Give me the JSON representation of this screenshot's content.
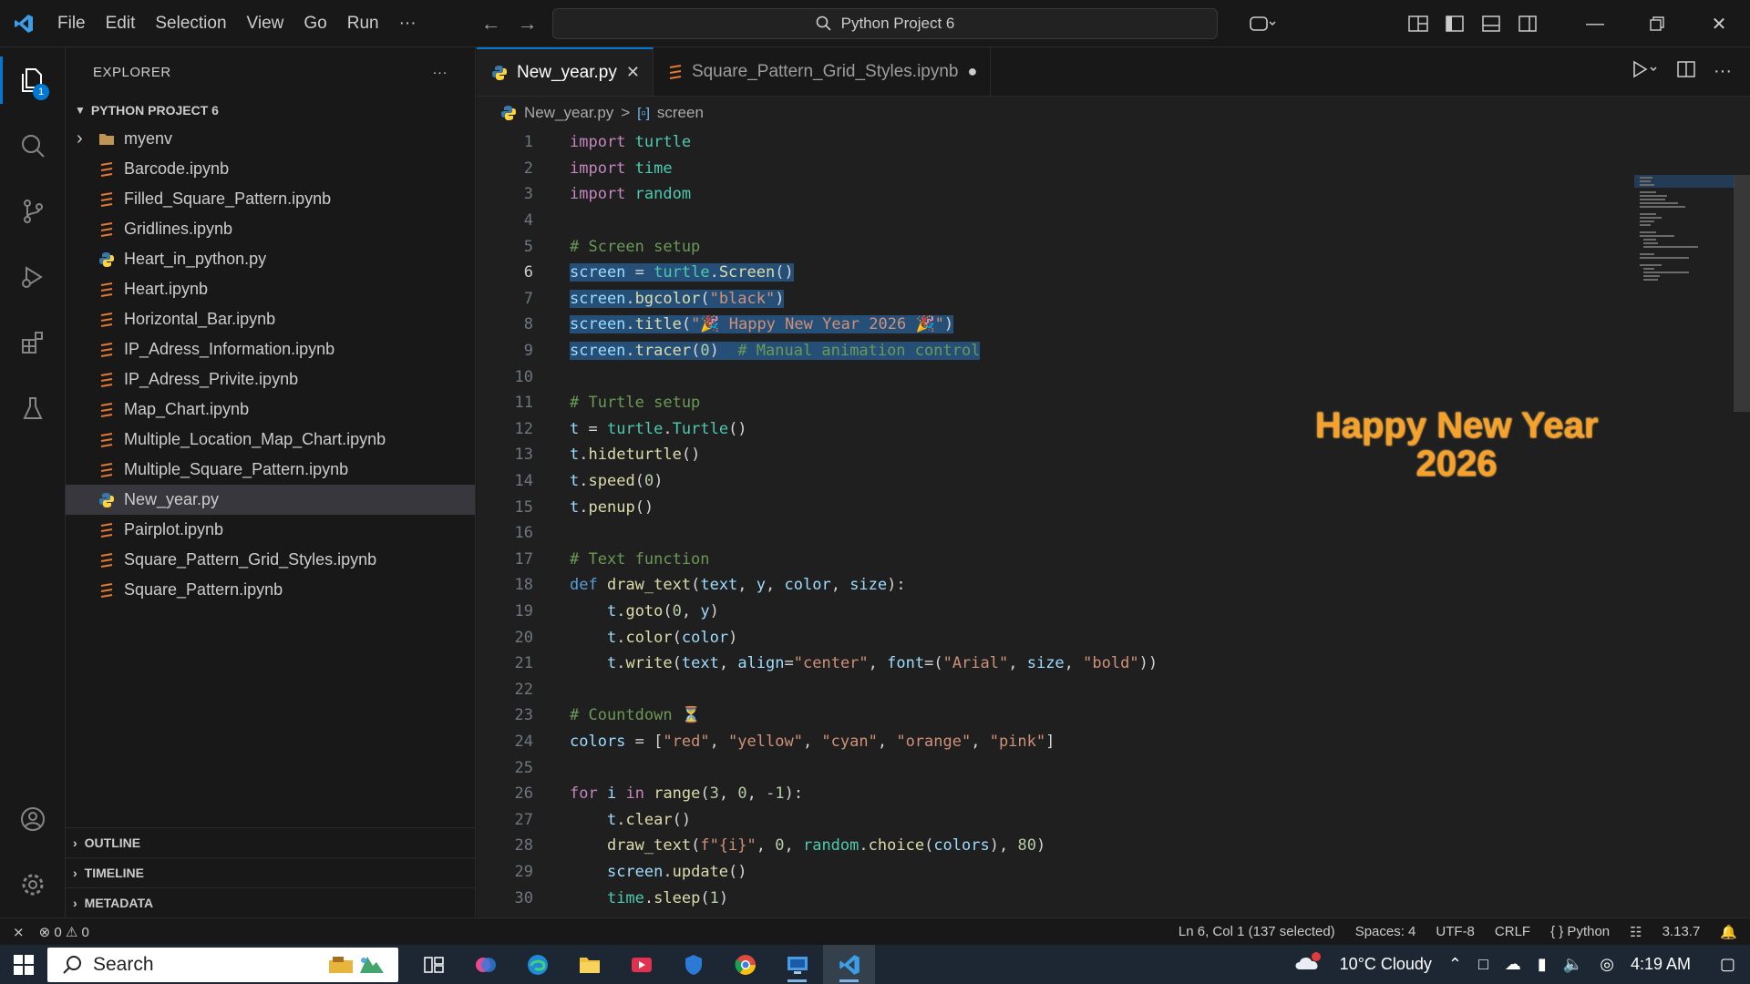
{
  "titlebar": {
    "menu": [
      "File",
      "Edit",
      "Selection",
      "View",
      "Go",
      "Run",
      "···"
    ],
    "search_text": "Python Project 6"
  },
  "activity": {
    "explorer_badge": "1"
  },
  "sidebar": {
    "title": "EXPLORER",
    "more": "···",
    "project": "PYTHON PROJECT 6",
    "items": [
      {
        "label": "myenv",
        "type": "folder"
      },
      {
        "label": "Barcode.ipynb",
        "type": "nb"
      },
      {
        "label": "Filled_Square_Pattern.ipynb",
        "type": "nb"
      },
      {
        "label": "Gridlines.ipynb",
        "type": "nb"
      },
      {
        "label": "Heart_in_python.py",
        "type": "py"
      },
      {
        "label": "Heart.ipynb",
        "type": "nb"
      },
      {
        "label": "Horizontal_Bar.ipynb",
        "type": "nb"
      },
      {
        "label": "IP_Adress_Information.ipynb",
        "type": "nb"
      },
      {
        "label": "IP_Adress_Privite.ipynb",
        "type": "nb"
      },
      {
        "label": "Map_Chart.ipynb",
        "type": "nb"
      },
      {
        "label": "Multiple_Location_Map_Chart.ipynb",
        "type": "nb"
      },
      {
        "label": "Multiple_Square_Pattern.ipynb",
        "type": "nb"
      },
      {
        "label": "New_year.py",
        "type": "py"
      },
      {
        "label": "Pairplot.ipynb",
        "type": "nb"
      },
      {
        "label": "Square_Pattern_Grid_Styles.ipynb",
        "type": "nb"
      },
      {
        "label": "Square_Pattern.ipynb",
        "type": "nb"
      }
    ],
    "sections": [
      "OUTLINE",
      "TIMELINE",
      "METADATA"
    ]
  },
  "tabs": [
    {
      "label": "New_year.py",
      "active": true
    },
    {
      "label": "Square_Pattern_Grid_Styles.ipynb",
      "active": false
    }
  ],
  "breadcrumb": {
    "file": "New_year.py",
    "sep": ">",
    "symbol": "screen"
  },
  "code_lines": [
    [
      [
        "kw",
        "import"
      ],
      [
        "pl",
        " "
      ],
      [
        "cls",
        "turtle"
      ]
    ],
    [
      [
        "kw",
        "import"
      ],
      [
        "pl",
        " "
      ],
      [
        "cls",
        "time"
      ]
    ],
    [
      [
        "kw",
        "import"
      ],
      [
        "pl",
        " "
      ],
      [
        "cls",
        "random"
      ]
    ],
    [],
    [
      [
        "cm",
        "# Screen setup"
      ]
    ],
    [
      [
        "var",
        "screen"
      ],
      [
        "pl",
        " = "
      ],
      [
        "cls",
        "turtle"
      ],
      [
        "pl",
        "."
      ],
      [
        "fn",
        "Screen"
      ],
      [
        "pl",
        "()"
      ]
    ],
    [
      [
        "var",
        "screen"
      ],
      [
        "pl",
        "."
      ],
      [
        "fn",
        "bgcolor"
      ],
      [
        "pl",
        "("
      ],
      [
        "str",
        "\"black\""
      ],
      [
        "pl",
        ")"
      ]
    ],
    [
      [
        "var",
        "screen"
      ],
      [
        "pl",
        "."
      ],
      [
        "fn",
        "title"
      ],
      [
        "pl",
        "("
      ],
      [
        "str",
        "\"🎉 Happy New Year 2026 🎉\""
      ],
      [
        "pl",
        ")"
      ]
    ],
    [
      [
        "var",
        "screen"
      ],
      [
        "pl",
        "."
      ],
      [
        "fn",
        "tracer"
      ],
      [
        "pl",
        "("
      ],
      [
        "num",
        "0"
      ],
      [
        "pl",
        ")  "
      ],
      [
        "cm",
        "# Manual animation control"
      ]
    ],
    [],
    [
      [
        "cm",
        "# Turtle setup"
      ]
    ],
    [
      [
        "var",
        "t"
      ],
      [
        "pl",
        " = "
      ],
      [
        "cls",
        "turtle"
      ],
      [
        "pl",
        "."
      ],
      [
        "cls",
        "Turtle"
      ],
      [
        "pl",
        "()"
      ]
    ],
    [
      [
        "var",
        "t"
      ],
      [
        "pl",
        "."
      ],
      [
        "fn",
        "hideturtle"
      ],
      [
        "pl",
        "()"
      ]
    ],
    [
      [
        "var",
        "t"
      ],
      [
        "pl",
        "."
      ],
      [
        "fn",
        "speed"
      ],
      [
        "pl",
        "("
      ],
      [
        "num",
        "0"
      ],
      [
        "pl",
        ")"
      ]
    ],
    [
      [
        "var",
        "t"
      ],
      [
        "pl",
        "."
      ],
      [
        "fn",
        "penup"
      ],
      [
        "pl",
        "()"
      ]
    ],
    [],
    [
      [
        "cm",
        "# Text function"
      ]
    ],
    [
      [
        "kb",
        "def"
      ],
      [
        "pl",
        " "
      ],
      [
        "fn",
        "draw_text"
      ],
      [
        "pl",
        "("
      ],
      [
        "var",
        "text"
      ],
      [
        "pl",
        ", "
      ],
      [
        "var",
        "y"
      ],
      [
        "pl",
        ", "
      ],
      [
        "var",
        "color"
      ],
      [
        "pl",
        ", "
      ],
      [
        "var",
        "size"
      ],
      [
        "pl",
        "):"
      ]
    ],
    [
      [
        "pl",
        "    "
      ],
      [
        "var",
        "t"
      ],
      [
        "pl",
        "."
      ],
      [
        "fn",
        "goto"
      ],
      [
        "pl",
        "("
      ],
      [
        "num",
        "0"
      ],
      [
        "pl",
        ", "
      ],
      [
        "var",
        "y"
      ],
      [
        "pl",
        ")"
      ]
    ],
    [
      [
        "pl",
        "    "
      ],
      [
        "var",
        "t"
      ],
      [
        "pl",
        "."
      ],
      [
        "fn",
        "color"
      ],
      [
        "pl",
        "("
      ],
      [
        "var",
        "color"
      ],
      [
        "pl",
        ")"
      ]
    ],
    [
      [
        "pl",
        "    "
      ],
      [
        "var",
        "t"
      ],
      [
        "pl",
        "."
      ],
      [
        "fn",
        "write"
      ],
      [
        "pl",
        "("
      ],
      [
        "var",
        "text"
      ],
      [
        "pl",
        ", "
      ],
      [
        "var",
        "align"
      ],
      [
        "pl",
        "="
      ],
      [
        "str",
        "\"center\""
      ],
      [
        "pl",
        ", "
      ],
      [
        "var",
        "font"
      ],
      [
        "pl",
        "=("
      ],
      [
        "str",
        "\"Arial\""
      ],
      [
        "pl",
        ", "
      ],
      [
        "var",
        "size"
      ],
      [
        "pl",
        ", "
      ],
      [
        "str",
        "\"bold\""
      ],
      [
        "pl",
        "))"
      ]
    ],
    [],
    [
      [
        "cm",
        "# Countdown ⏳"
      ]
    ],
    [
      [
        "var",
        "colors"
      ],
      [
        "pl",
        " = ["
      ],
      [
        "str",
        "\"red\""
      ],
      [
        "pl",
        ", "
      ],
      [
        "str",
        "\"yellow\""
      ],
      [
        "pl",
        ", "
      ],
      [
        "str",
        "\"cyan\""
      ],
      [
        "pl",
        ", "
      ],
      [
        "str",
        "\"orange\""
      ],
      [
        "pl",
        ", "
      ],
      [
        "str",
        "\"pink\""
      ],
      [
        "pl",
        "]"
      ]
    ],
    [],
    [
      [
        "kw",
        "for"
      ],
      [
        "pl",
        " "
      ],
      [
        "var",
        "i"
      ],
      [
        "pl",
        " "
      ],
      [
        "kw",
        "in"
      ],
      [
        "pl",
        " "
      ],
      [
        "fn",
        "range"
      ],
      [
        "pl",
        "("
      ],
      [
        "num",
        "3"
      ],
      [
        "pl",
        ", "
      ],
      [
        "num",
        "0"
      ],
      [
        "pl",
        ", "
      ],
      [
        "num",
        "-1"
      ],
      [
        "pl",
        "):"
      ]
    ],
    [
      [
        "pl",
        "    "
      ],
      [
        "var",
        "t"
      ],
      [
        "pl",
        "."
      ],
      [
        "fn",
        "clear"
      ],
      [
        "pl",
        "()"
      ]
    ],
    [
      [
        "pl",
        "    "
      ],
      [
        "fn",
        "draw_text"
      ],
      [
        "pl",
        "("
      ],
      [
        "str",
        "f\"{i}\""
      ],
      [
        "pl",
        ", "
      ],
      [
        "num",
        "0"
      ],
      [
        "pl",
        ", "
      ],
      [
        "cls",
        "random"
      ],
      [
        "pl",
        "."
      ],
      [
        "fn",
        "choice"
      ],
      [
        "pl",
        "("
      ],
      [
        "var",
        "colors"
      ],
      [
        "pl",
        "), "
      ],
      [
        "num",
        "80"
      ],
      [
        "pl",
        ")"
      ]
    ],
    [
      [
        "pl",
        "    "
      ],
      [
        "var",
        "screen"
      ],
      [
        "pl",
        "."
      ],
      [
        "fn",
        "update"
      ],
      [
        "pl",
        "()"
      ]
    ],
    [
      [
        "pl",
        "    "
      ],
      [
        "cls",
        "time"
      ],
      [
        "pl",
        "."
      ],
      [
        "fn",
        "sleep"
      ],
      [
        "pl",
        "("
      ],
      [
        "num",
        "1"
      ],
      [
        "pl",
        ")"
      ]
    ]
  ],
  "selection": {
    "first_line": 6,
    "last_line": 9,
    "cursor_line": 6
  },
  "preview": {
    "line1": "Happy New Year",
    "line2": "2026"
  },
  "statusbar": {
    "remote": "⨯",
    "problems": "⊗ 0 ⚠ 0",
    "position": "Ln 6, Col 1 (137 selected)",
    "spaces": "Spaces: 4",
    "encoding": "UTF-8",
    "eol": "CRLF",
    "language": "{ } Python",
    "version": "3.13.7"
  },
  "taskbar": {
    "search_placeholder": "Search",
    "weather": "10°C  Cloudy",
    "time": "4:19 AM"
  },
  "colors": {
    "accent": "#0078d4",
    "selection": "#264f78",
    "preview_text": "#f7a128"
  }
}
